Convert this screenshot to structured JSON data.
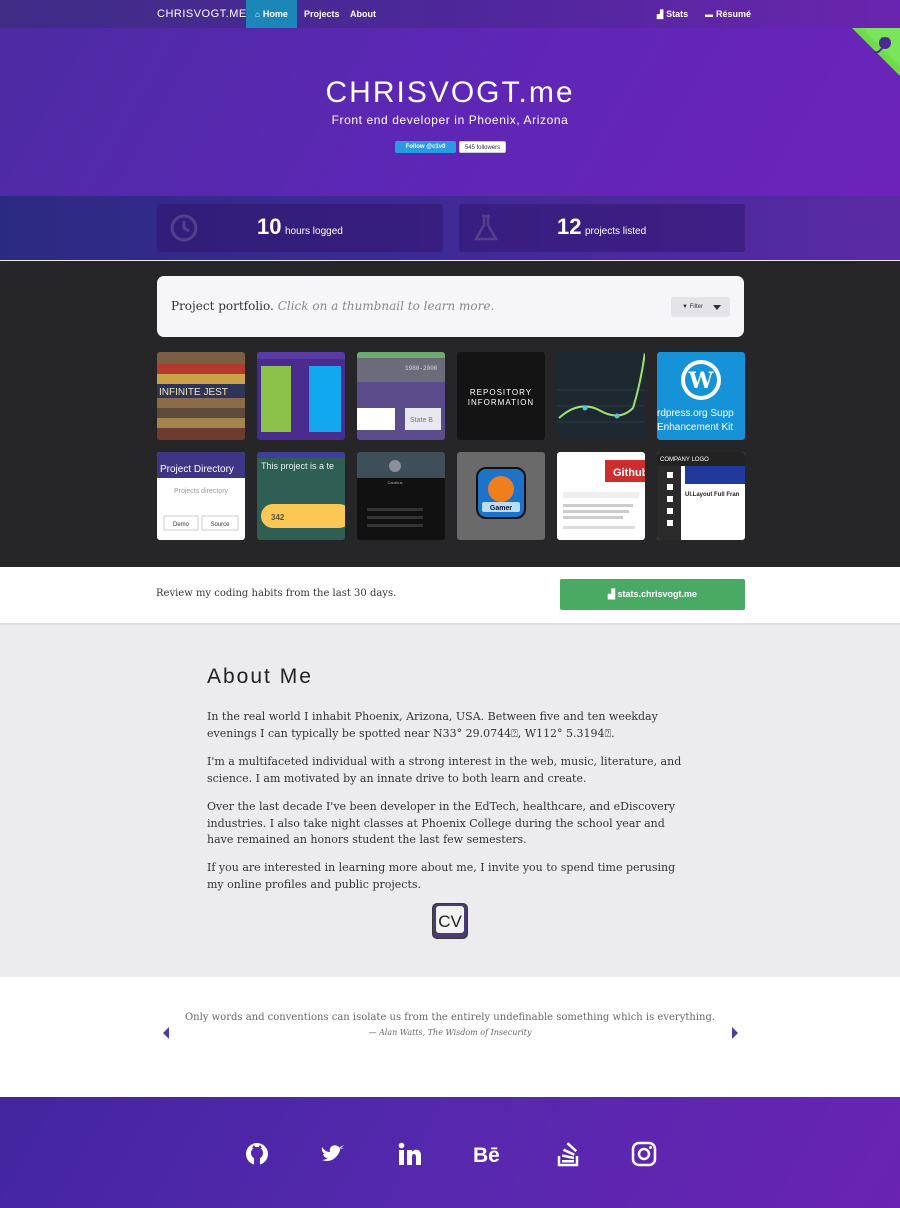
{
  "nav": {
    "brand": "CHRISVOGT.ME",
    "links": [
      {
        "label": "Home",
        "icon": "home-icon",
        "active": true
      },
      {
        "label": "Projects",
        "active": false
      },
      {
        "label": "About",
        "active": false
      }
    ],
    "right_links": [
      {
        "label": "Stats",
        "icon": "chart-icon"
      },
      {
        "label": "Résumé",
        "icon": "briefcase-icon"
      }
    ]
  },
  "hero": {
    "title": "CHRISVOGT.me",
    "subtitle": "Front end developer in Phoenix, Arizona",
    "follow_label": "Follow @c1v0",
    "followers": "545 followers"
  },
  "stats": [
    {
      "value": "10",
      "label": "hours logged",
      "icon": "clock-icon"
    },
    {
      "value": "12",
      "label": "projects listed",
      "icon": "flask-icon"
    }
  ],
  "portfolio": {
    "heading": "Project portfolio.",
    "hint": "Click on a thumbnail to learn more.",
    "filter_label": "Filter",
    "thumbnails": [
      {
        "caption": "INFINITE JEST"
      },
      {
        "caption": ""
      },
      {
        "caption": "1980-2000",
        "extra": "State B"
      },
      {
        "caption": "REPOSITORY",
        "extra": "INFORMATION"
      },
      {
        "caption": ""
      },
      {
        "caption": "rdpress.org Supp",
        "extra": "Enhancement Kit"
      },
      {
        "caption": "Project Directory",
        "extra": "Projects directory",
        "demo": "Demo",
        "source": "Source"
      },
      {
        "caption": "This project is a te",
        "extra": "342"
      },
      {
        "caption": "Cardbus"
      },
      {
        "caption": "Gamer"
      },
      {
        "caption": "Github"
      },
      {
        "caption": "COMPANY LOGO",
        "extra": "UI.Layout Full Fran"
      }
    ]
  },
  "cta": {
    "text": "Review my coding habits from the last 30 days.",
    "button": "stats.chrisvogt.me"
  },
  "about": {
    "title": "About Me",
    "paragraphs": [
      "In the real world I inhabit Phoenix, Arizona, USA. Between five and ten weekday evenings I can typically be spotted near N33° 29.0744⍰, W112° 5.3194⍰.",
      "I'm a multifaceted individual with a strong interest in the web, music, literature, and science. I am motivated by an innate drive to both learn and create.",
      "Over the last decade I've been developer in the EdTech, healthcare, and eDiscovery industries. I also take night classes at Phoenix College during the school year and have remained an honors student the last few semesters.",
      "If you are interested in learning more about me, I invite you to spend time perusing my online profiles and public projects."
    ],
    "cv_label": "CV"
  },
  "quote": {
    "text": "Only words and conventions can isolate us from the entirely undefinable something which is everything.",
    "author": "— Alan Watts, ",
    "source": "The Wisdom of Insecurity"
  },
  "footer": {
    "social": [
      "github-icon",
      "twitter-icon",
      "linkedin-icon",
      "behance-icon",
      "stackoverflow-icon",
      "instagram-icon"
    ]
  },
  "colors": {
    "accent": "#1c86b8",
    "purple": "#5628ae",
    "green": "#4aaa64",
    "dark": "#262528"
  }
}
